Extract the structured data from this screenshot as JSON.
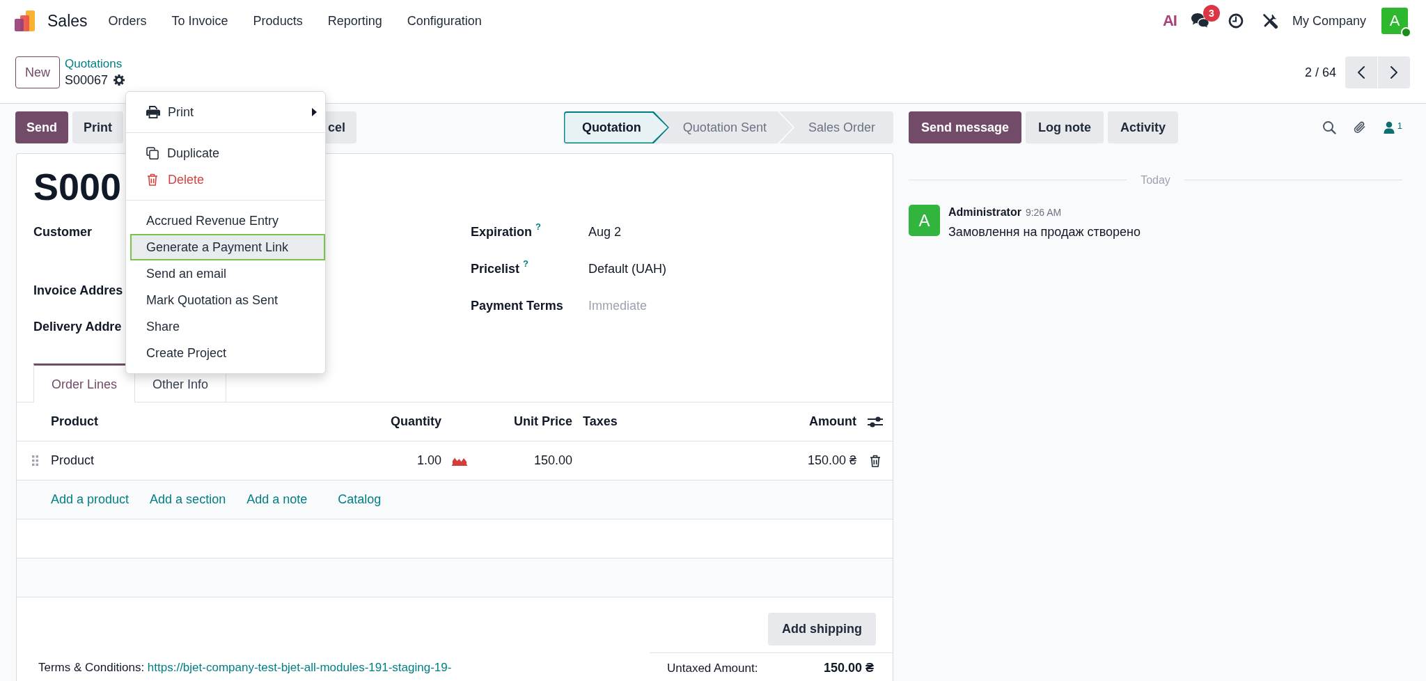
{
  "navbar": {
    "app_name": "Sales",
    "menu": [
      "Orders",
      "To Invoice",
      "Products",
      "Reporting",
      "Configuration"
    ],
    "ai_label": "AI",
    "chat_badge": "3",
    "company": "My Company",
    "avatar_letter": "A",
    "avatar_online": true
  },
  "control_panel": {
    "new_button": "New",
    "breadcrumb": "Quotations",
    "record_name": "S00067",
    "pager": "2 / 64"
  },
  "action_buttons": [
    {
      "label": "Send",
      "kind": "primary"
    },
    {
      "label": "Print",
      "kind": "secondary"
    },
    {
      "label": "cel",
      "kind": "clipped"
    }
  ],
  "statusbar": [
    {
      "label": "Quotation",
      "selected": true
    },
    {
      "label": "Quotation Sent",
      "selected": false
    },
    {
      "label": "Sales Order",
      "selected": false
    }
  ],
  "form": {
    "title": "S000",
    "left_fields": [
      "Customer",
      "Invoice Addres",
      "Delivery Addre"
    ],
    "right_fields": [
      {
        "label": "Expiration",
        "help": "?",
        "value": "Aug 2"
      },
      {
        "label": "Pricelist",
        "help": "?",
        "value": "Default (UAH)"
      },
      {
        "label": "Payment Terms",
        "placeholder": "Immediate"
      }
    ]
  },
  "tabs": [
    {
      "label": "Order Lines",
      "selected": true
    },
    {
      "label": "Other Info",
      "selected": false
    }
  ],
  "order_lines": {
    "columns": [
      "Product",
      "Quantity",
      "Unit Price",
      "Taxes",
      "Amount"
    ],
    "rows": [
      {
        "product": "Product",
        "quantity": "1.00",
        "unit_price": "150.00",
        "amount": "150.00 ₴"
      }
    ],
    "add_links": [
      "Add a product",
      "Add a section",
      "Add a note",
      "Catalog"
    ]
  },
  "add_shipping": "Add shipping",
  "terms": {
    "label": "Terms & Conditions:",
    "link": "https://bjet-company-test-bjet-all-modules-191-staging-19-"
  },
  "totals": [
    {
      "label": "Untaxed Amount:",
      "value": "150.00 ₴"
    }
  ],
  "chatter": {
    "buttons": [
      {
        "label": "Send message",
        "kind": "primary"
      },
      {
        "label": "Log note",
        "kind": "secondary"
      },
      {
        "label": "Activity",
        "kind": "secondary"
      }
    ],
    "follower_count": "1",
    "date_divider": "Today",
    "messages": [
      {
        "avatar_letter": "A",
        "author": "Administrator",
        "time": "9:26 AM",
        "body": "Замовлення на продаж створено"
      }
    ]
  },
  "dropdown": {
    "sections": [
      {
        "items": [
          {
            "label": "Print",
            "kind": "submenu",
            "highlighted": false
          }
        ]
      },
      {
        "items": [
          {
            "label": "Duplicate",
            "kind": "copy",
            "highlighted": false
          },
          {
            "label": "Delete",
            "kind": "delete",
            "highlighted": false
          }
        ]
      },
      {
        "items": [
          {
            "label": "Accrued Revenue Entry",
            "kind": "plain",
            "highlighted": false
          },
          {
            "label": "Generate a Payment Link",
            "kind": "plain",
            "highlighted": true
          },
          {
            "label": "Send an email",
            "kind": "plain",
            "highlighted": false
          },
          {
            "label": "Mark Quotation as Sent",
            "kind": "plain",
            "highlighted": false
          },
          {
            "label": "Share",
            "kind": "plain",
            "highlighted": false
          },
          {
            "label": "Create Project",
            "kind": "plain",
            "highlighted": false
          }
        ]
      }
    ]
  }
}
